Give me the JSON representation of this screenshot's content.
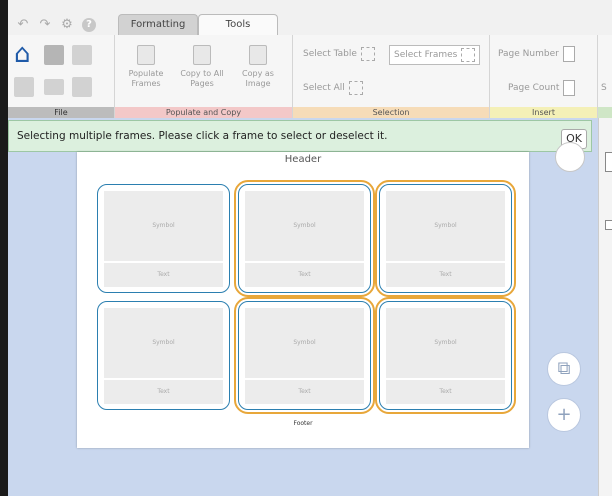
{
  "tabs": [
    {
      "label": "Formatting"
    },
    {
      "label": "Tools"
    }
  ],
  "groups": {
    "file": {
      "label": "File"
    },
    "populate": {
      "label": "Populate and Copy",
      "buttons": [
        {
          "label": "Populate Frames"
        },
        {
          "label": "Copy to All Pages"
        },
        {
          "label": "Copy as Image"
        }
      ]
    },
    "selection": {
      "label": "Selection",
      "select_table": "Select Table",
      "select_frames": "Select Frames",
      "select_all": "Select All"
    },
    "insert": {
      "label": "Insert",
      "page_number": "Page Number",
      "page_count": "Page Count"
    },
    "partial": {
      "label": "S"
    }
  },
  "notification": {
    "message": "Selecting multiple frames. Please click a frame to select or deselect it.",
    "ok_label": "OK"
  },
  "page": {
    "header": "Header",
    "footer": "Footer",
    "cells": [
      {
        "symbol": "Symbol",
        "text": "Text",
        "selected": false
      },
      {
        "symbol": "Symbol",
        "text": "Text",
        "selected": true
      },
      {
        "symbol": "Symbol",
        "text": "Text",
        "selected": true
      },
      {
        "symbol": "Symbol",
        "text": "Text",
        "selected": false
      },
      {
        "symbol": "Symbol",
        "text": "Text",
        "selected": true
      },
      {
        "symbol": "Symbol",
        "text": "Text",
        "selected": true
      }
    ]
  },
  "icons": {
    "undo": "undo-icon",
    "redo": "redo-icon",
    "settings": "gear-icon",
    "help": "help-icon",
    "home": "home-icon",
    "save": "save-icon",
    "copy_page": "copy-page-icon",
    "add_page": "add-page-icon"
  },
  "colors": {
    "accent_blue": "#1f5aa8",
    "selection_orange": "#e8a73a",
    "frame_border": "#2b7fb0",
    "notification_bg": "#dcf0de"
  }
}
